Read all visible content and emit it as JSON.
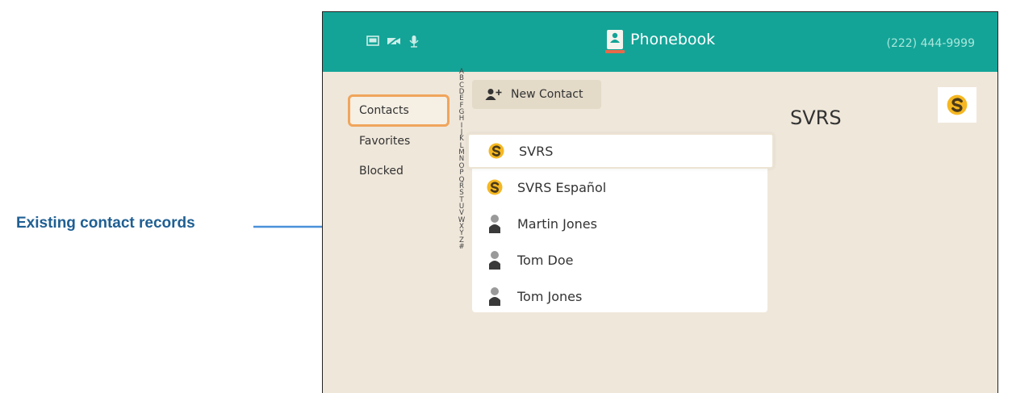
{
  "annotation": {
    "label": "Existing contact records",
    "color": "#1f5f93"
  },
  "header": {
    "title": "Phonebook",
    "phone_number": "(222) 444-9999",
    "status_icons": [
      "screen-icon",
      "video-off-icon",
      "microphone-icon"
    ],
    "accent_color": "#13a497"
  },
  "sidebar": {
    "items": [
      {
        "label": "Contacts",
        "active": true
      },
      {
        "label": "Favorites",
        "active": false
      },
      {
        "label": "Blocked",
        "active": false
      }
    ]
  },
  "alphabet": [
    "A",
    "B",
    "C",
    "D",
    "E",
    "F",
    "G",
    "H",
    "I",
    "J",
    "K",
    "L",
    "M",
    "N",
    "O",
    "P",
    "Q",
    "R",
    "S",
    "T",
    "U",
    "V",
    "W",
    "X",
    "Y",
    "Z",
    "#"
  ],
  "toolbar": {
    "new_contact_label": "New Contact",
    "new_contact_icon": "add-person-icon"
  },
  "contacts": [
    {
      "name": "SVRS",
      "icon": "svrs-logo-icon",
      "selected": true
    },
    {
      "name": "SVRS Español",
      "icon": "svrs-logo-icon",
      "selected": false
    },
    {
      "name": "Martin Jones",
      "icon": "person-icon",
      "selected": false
    },
    {
      "name": "Tom Doe",
      "icon": "person-icon",
      "selected": false
    },
    {
      "name": "Tom Jones",
      "icon": "person-icon",
      "selected": false
    }
  ],
  "detail": {
    "name": "SVRS",
    "logo_icon": "svrs-logo-icon"
  }
}
